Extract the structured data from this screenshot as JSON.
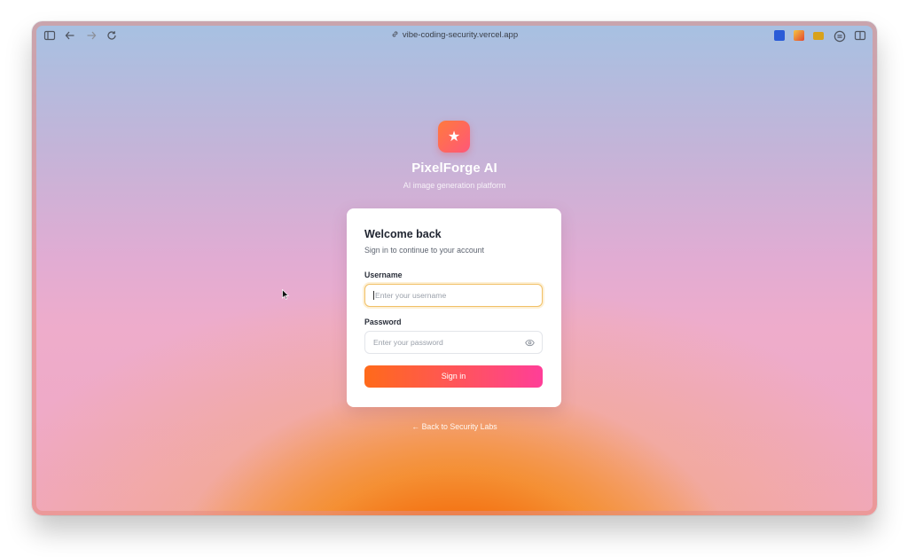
{
  "browser": {
    "url": "vibe-coding-security.vercel.app",
    "icons": [
      "sidebar-icon",
      "back-arrow-icon",
      "forward-arrow-icon",
      "reload-icon",
      "link-icon",
      "extension-icon-1",
      "extension-icon-2",
      "extension-icon-3",
      "extension-icon-4",
      "split-view-icon"
    ]
  },
  "brand": {
    "name": "PixelForge AI",
    "tagline": "AI image generation platform",
    "logo_icon": "star-icon",
    "logo_colors": [
      "#ff7a3d",
      "#ff5778"
    ]
  },
  "login": {
    "title": "Welcome back",
    "subtitle": "Sign in to continue to your account",
    "username_label": "Username",
    "username_placeholder": "Enter your username",
    "username_value": "",
    "password_label": "Password",
    "password_placeholder": "Enter your password",
    "password_value": "",
    "submit_label": "Sign in",
    "submit_gradient": [
      "#ff6a1a",
      "#ff3e98"
    ]
  },
  "footer": {
    "back_link": "← Back to Security Labs"
  }
}
